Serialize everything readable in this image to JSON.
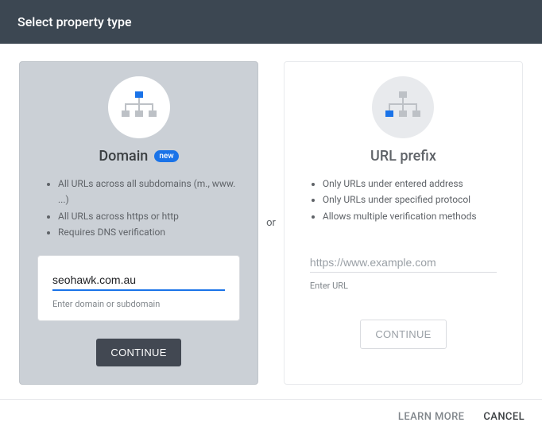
{
  "header": {
    "title": "Select property type"
  },
  "separator": "or",
  "domainCard": {
    "title": "Domain",
    "badge": "new",
    "features": [
      "All URLs across all subdomains (m., www. ...)",
      "All URLs across https or http",
      "Requires DNS verification"
    ],
    "input": {
      "value": "seohawk.com.au",
      "helper": "Enter domain or subdomain"
    },
    "button": "CONTINUE"
  },
  "urlPrefixCard": {
    "title": "URL prefix",
    "features": [
      "Only URLs under entered address",
      "Only URLs under specified protocol",
      "Allows multiple verification methods"
    ],
    "input": {
      "placeholder": "https://www.example.com",
      "helper": "Enter URL"
    },
    "button": "CONTINUE"
  },
  "footer": {
    "learnMore": "LEARN MORE",
    "cancel": "CANCEL"
  }
}
